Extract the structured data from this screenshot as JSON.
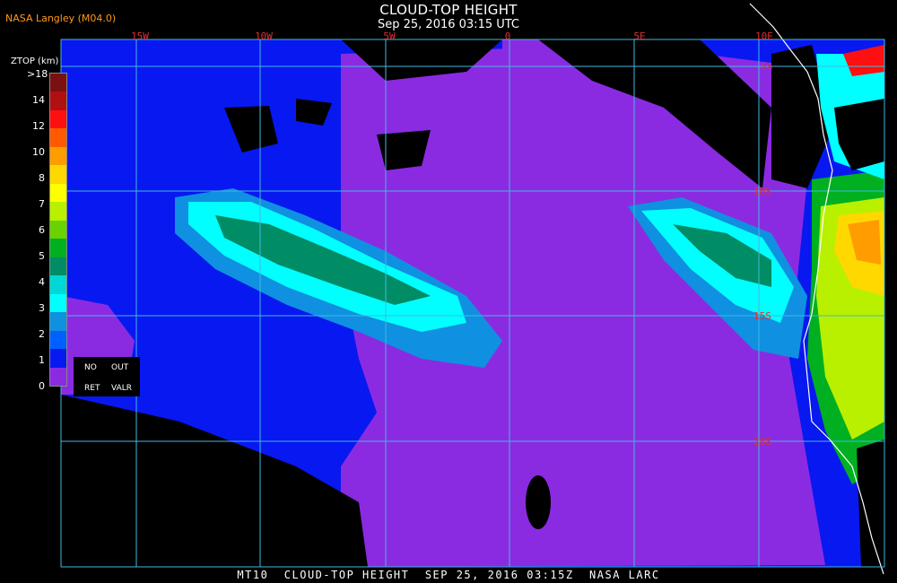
{
  "header": {
    "credit": "NASA Langley (M04.0)",
    "title": "CLOUD-TOP HEIGHT",
    "subtitle": "Sep 25, 2016 03:15 UTC"
  },
  "footer": {
    "caption": "MT10  CLOUD-TOP HEIGHT  SEP 25, 2016 03:15Z  NASA LARC"
  },
  "map": {
    "lon_labels": [
      "15W",
      "10W",
      "5W",
      "0",
      "5E",
      "10E"
    ],
    "lat_labels": [
      "5S",
      "10S",
      "15S",
      "20S"
    ],
    "grid_color": "#40b8e0",
    "label_color": "#e03030",
    "coast_color": "#ffffff"
  },
  "colorbar": {
    "title": "ZTOP (km)",
    "labels": [
      ">18",
      "14",
      "12",
      "10",
      "8",
      "7",
      "6",
      "5",
      "4",
      "3",
      "2",
      "1",
      "0"
    ],
    "colors": [
      "#7a1010",
      "#b01010",
      "#ff1010",
      "#ff5a00",
      "#ff9c00",
      "#ffd800",
      "#ffff00",
      "#b8f000",
      "#6ad200",
      "#00b020",
      "#008c64",
      "#00d8d8",
      "#00ffff",
      "#1090e0",
      "#0060ff",
      "#0818f0",
      "#8a2be2"
    ],
    "flags": [
      "NO",
      "OUT",
      "RET",
      "VALR"
    ]
  }
}
